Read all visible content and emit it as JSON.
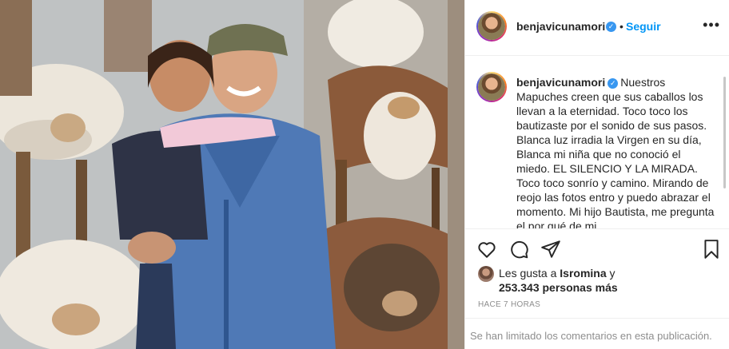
{
  "post": {
    "username": "benjavicunamori",
    "verified_badge": "✓",
    "separator": "•",
    "follow_label": "Seguir",
    "more_glyph": "•••",
    "caption_text": "Nuestros Mapuches creen que sus caballos los llevan a la eternidad. Toco toco los bautizaste por el sonido de sus pasos. Blanca luz irradia la Virgen en su día, Blanca mi niña que no conoció el miedo. EL SILENCIO Y LA MIRADA. Toco toco sonrío y camino. Mirando de reojo las fotos entro y puedo abrazar el momento. Mi hijo Bautista, me pregunta el por qué de mi",
    "likes_prefix": "Les gusta a",
    "likes_user": "Isromina",
    "likes_and": "y",
    "likes_count": "253.343 personas más",
    "timestamp": "HACE 7 HORAS",
    "comments_limited": "Se han limitado los comentarios en esta publicación."
  },
  "icons": [
    "heart-icon",
    "comment-icon",
    "share-icon",
    "bookmark-icon",
    "verified-icon",
    "more-options-icon"
  ],
  "colors": {
    "accent": "#0095f6",
    "verified": "#3897f0",
    "text": "#262626",
    "muted": "#8e8e8e",
    "border": "#efefef"
  }
}
